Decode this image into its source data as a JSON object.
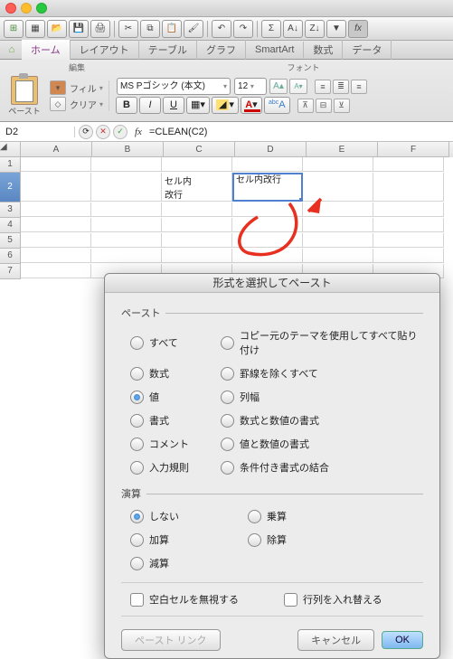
{
  "menu": {
    "home": "ホーム",
    "layout": "レイアウト",
    "tables": "テーブル",
    "charts": "グラフ",
    "smartart": "SmartArt",
    "formulas": "数式",
    "data": "データ"
  },
  "ribbon": {
    "group_edit": "編集",
    "group_font": "フォント",
    "paste": "ペースト",
    "fill": "フィル",
    "clear": "クリア",
    "font_name": "MS Pゴシック (本文)",
    "font_size": "12",
    "btn_b": "B",
    "btn_i": "I",
    "btn_u": "U",
    "color_A": "A",
    "color_A2": "A",
    "abc": "abc"
  },
  "nb": {
    "cell_ref": "D2",
    "formula": "=CLEAN(C2)"
  },
  "sheet": {
    "cols": [
      "A",
      "B",
      "C",
      "D",
      "E",
      "F"
    ],
    "rows": [
      "1",
      "2",
      "3",
      "4",
      "5",
      "6",
      "7"
    ],
    "c2_line1": "セル内",
    "c2_line2": "改行",
    "d2": "セル内改行"
  },
  "dlg": {
    "title": "形式を選択してペースト",
    "sec_paste": "ペースト",
    "opt_all": "すべて",
    "opt_theme": "コピー元のテーマを使用してすべて貼り付け",
    "opt_formula": "数式",
    "opt_noborder": "罫線を除くすべて",
    "opt_value": "値",
    "opt_width": "列幅",
    "opt_format": "書式",
    "opt_fmtnum": "数式と数値の書式",
    "opt_comment": "コメント",
    "opt_valnum": "値と数値の書式",
    "opt_valid": "入力規則",
    "opt_cond": "条件付き書式の結合",
    "sec_op": "演算",
    "op_none": "しない",
    "op_mul": "乗算",
    "op_add": "加算",
    "op_div": "除算",
    "op_sub": "減算",
    "skip": "空白セルを無視する",
    "trans": "行列を入れ替える",
    "link": "ペースト リンク",
    "cancel": "キャンセル",
    "ok": "OK"
  }
}
